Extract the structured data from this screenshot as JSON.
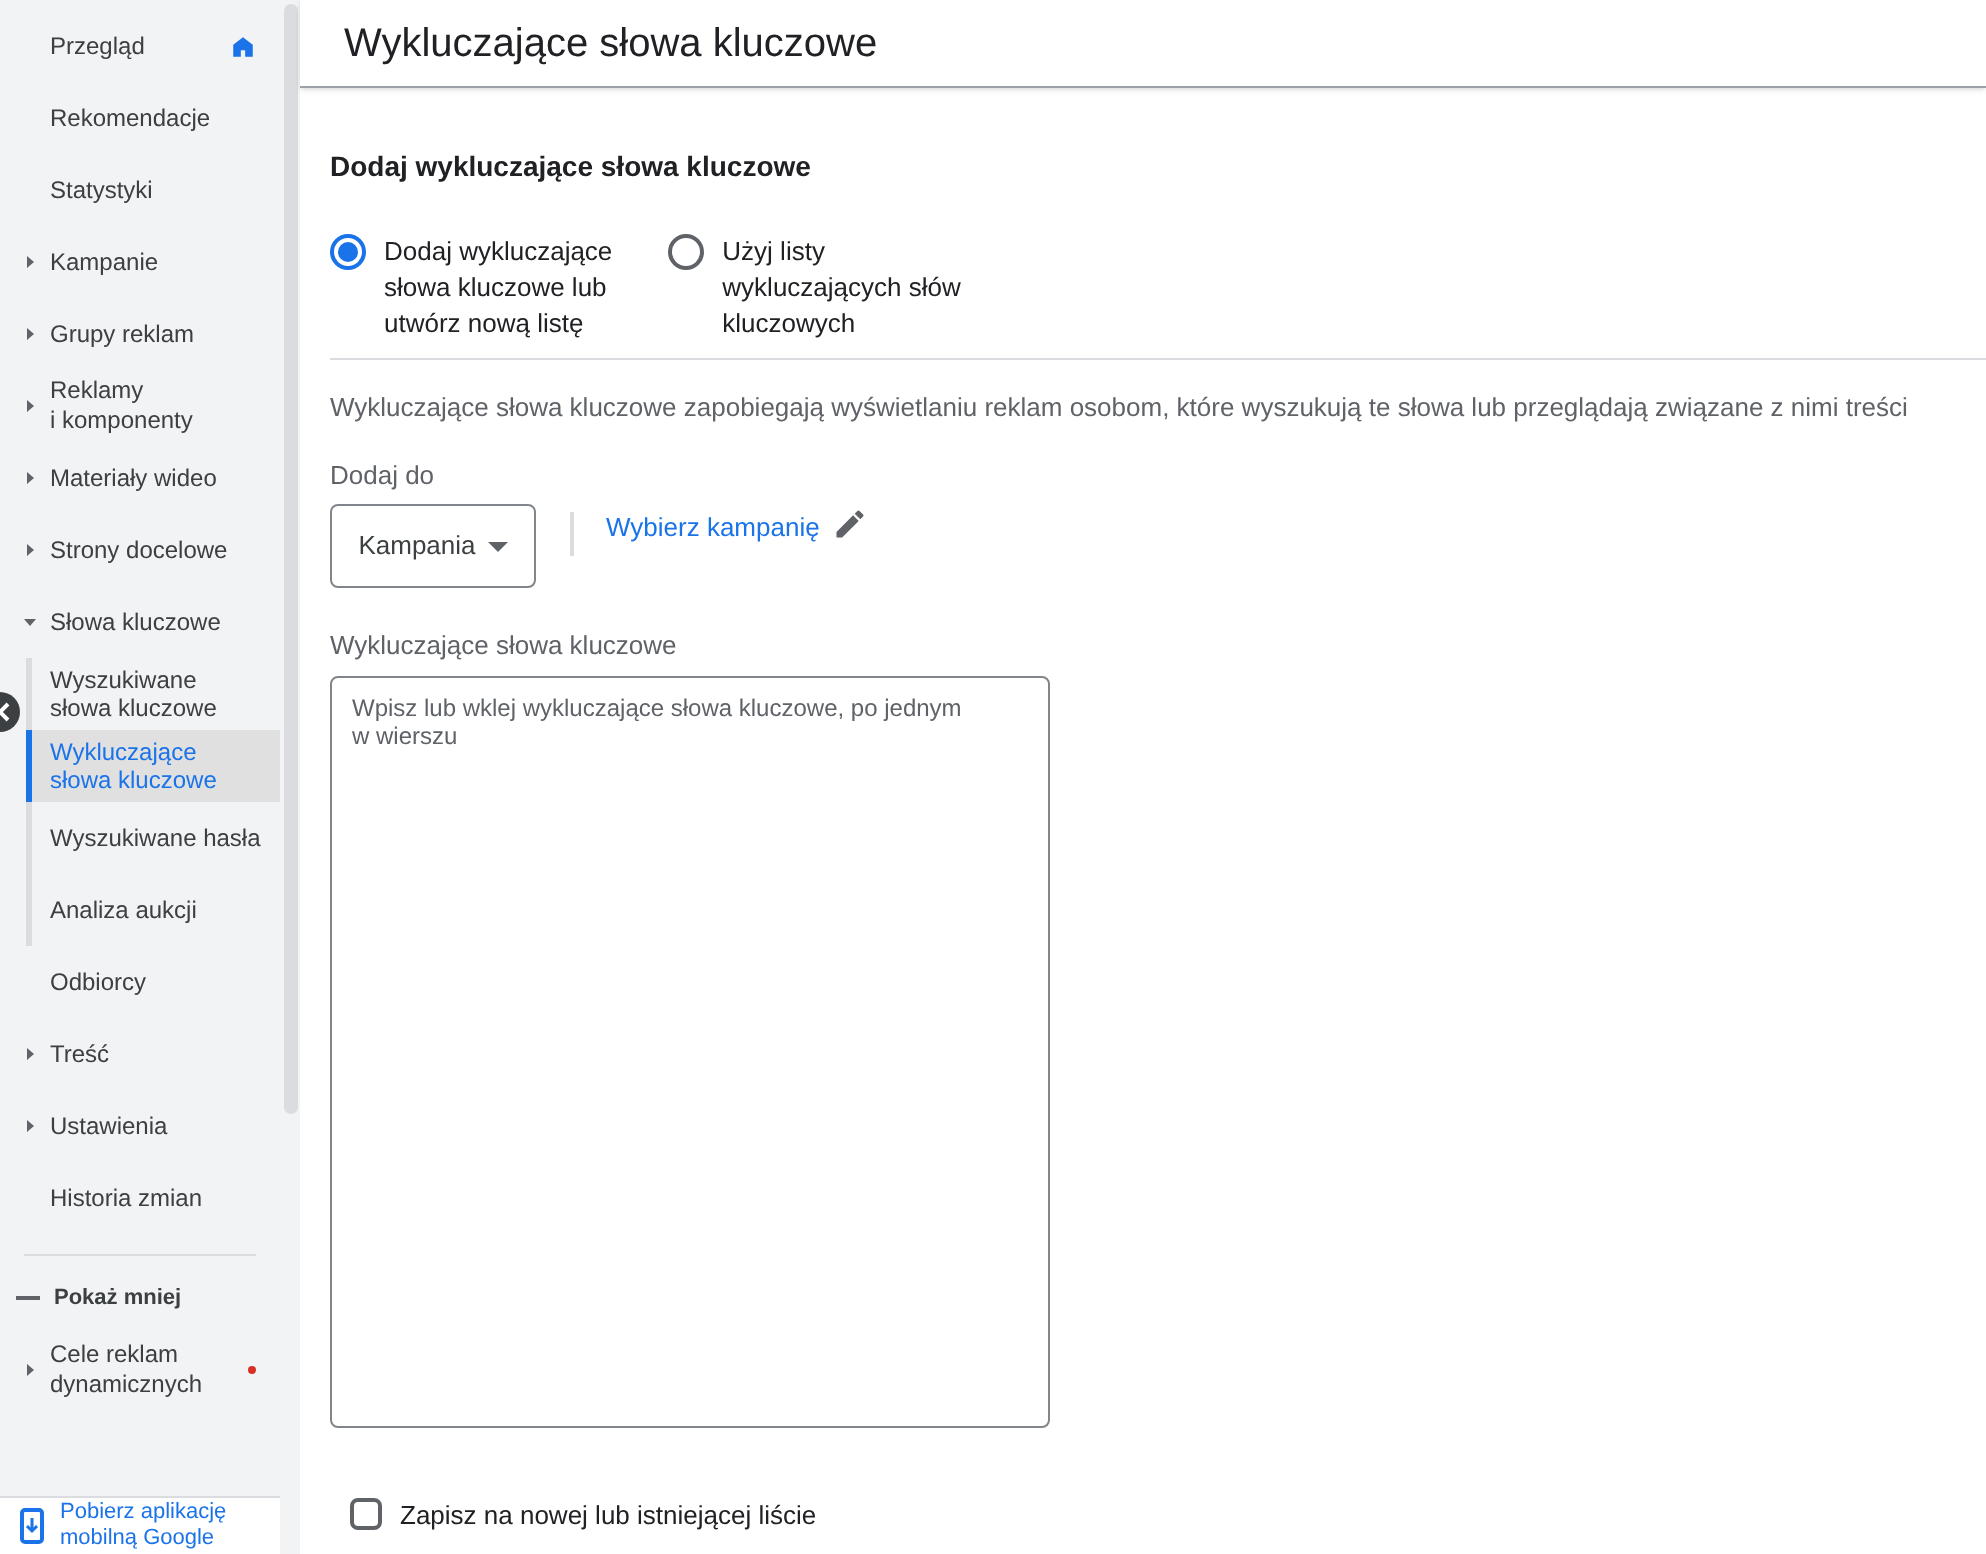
{
  "sidebar": {
    "items": [
      {
        "label": "Przegląd",
        "kind": "home",
        "selected": false
      },
      {
        "label": "Rekomendacje",
        "kind": "link",
        "selected": false
      },
      {
        "label": "Statystyki",
        "kind": "link",
        "selected": false
      },
      {
        "label": "Kampanie",
        "kind": "group",
        "expanded": false,
        "selected": false
      },
      {
        "label": "Grupy reklam",
        "kind": "group",
        "expanded": false,
        "selected": false
      },
      {
        "label": "Reklamy\ni komponenty",
        "kind": "group",
        "expanded": false,
        "selected": false
      },
      {
        "label": "Materiały wideo",
        "kind": "group",
        "expanded": false,
        "selected": false
      },
      {
        "label": "Strony docelowe",
        "kind": "group",
        "expanded": false,
        "selected": false
      },
      {
        "label": "Słowa kluczowe",
        "kind": "group",
        "expanded": true,
        "selected": false,
        "children": [
          {
            "label": "Wyszukiwane\nsłowa kluczowe",
            "selected": false
          },
          {
            "label": "Wykluczające\nsłowa kluczowe",
            "selected": true
          },
          {
            "label": "Wyszukiwane hasła",
            "selected": false
          },
          {
            "label": "Analiza aukcji",
            "selected": false
          }
        ]
      },
      {
        "label": "Odbiorcy",
        "kind": "link",
        "selected": false
      },
      {
        "label": "Treść",
        "kind": "group",
        "expanded": false,
        "selected": false
      },
      {
        "label": "Ustawienia",
        "kind": "group",
        "expanded": false,
        "selected": false
      },
      {
        "label": "Historia zmian",
        "kind": "link",
        "selected": false
      }
    ],
    "toggle": "Pokaż mniej",
    "extra": {
      "label": "Cele reklam\ndynamicznych",
      "kind": "group-alert",
      "expanded": false,
      "selected": false
    },
    "app_banner": "Pobierz aplikację\nmobilną Google"
  },
  "page": {
    "title": "Wykluczające słowa kluczowe",
    "section_title": "Dodaj wykluczające słowa kluczowe",
    "options": [
      {
        "label": "Dodaj wykluczające\nsłowa kluczowe lub\nutwórz nową listę",
        "selected": true
      },
      {
        "label": "Użyj listy\nwykluczających słów\nkluczowych",
        "selected": false
      }
    ],
    "description": "Wykluczające słowa kluczowe zapobiegają wyświetlaniu reklam osobom, które wyszukują te słowa lub przeglądają związane z nimi treści",
    "add_to_label": "Dodaj do",
    "add_to_value": "Kampania",
    "campaign_link": "Wybierz kampanię",
    "keywords_label": "Wykluczające słowa kluczowe",
    "keywords_placeholder": "Wpisz lub wklej wykluczające słowa kluczowe, po jednym\nw wierszu",
    "save_checkbox": {
      "label": "Zapisz na nowej lub istniejącej liście",
      "checked": false
    }
  }
}
